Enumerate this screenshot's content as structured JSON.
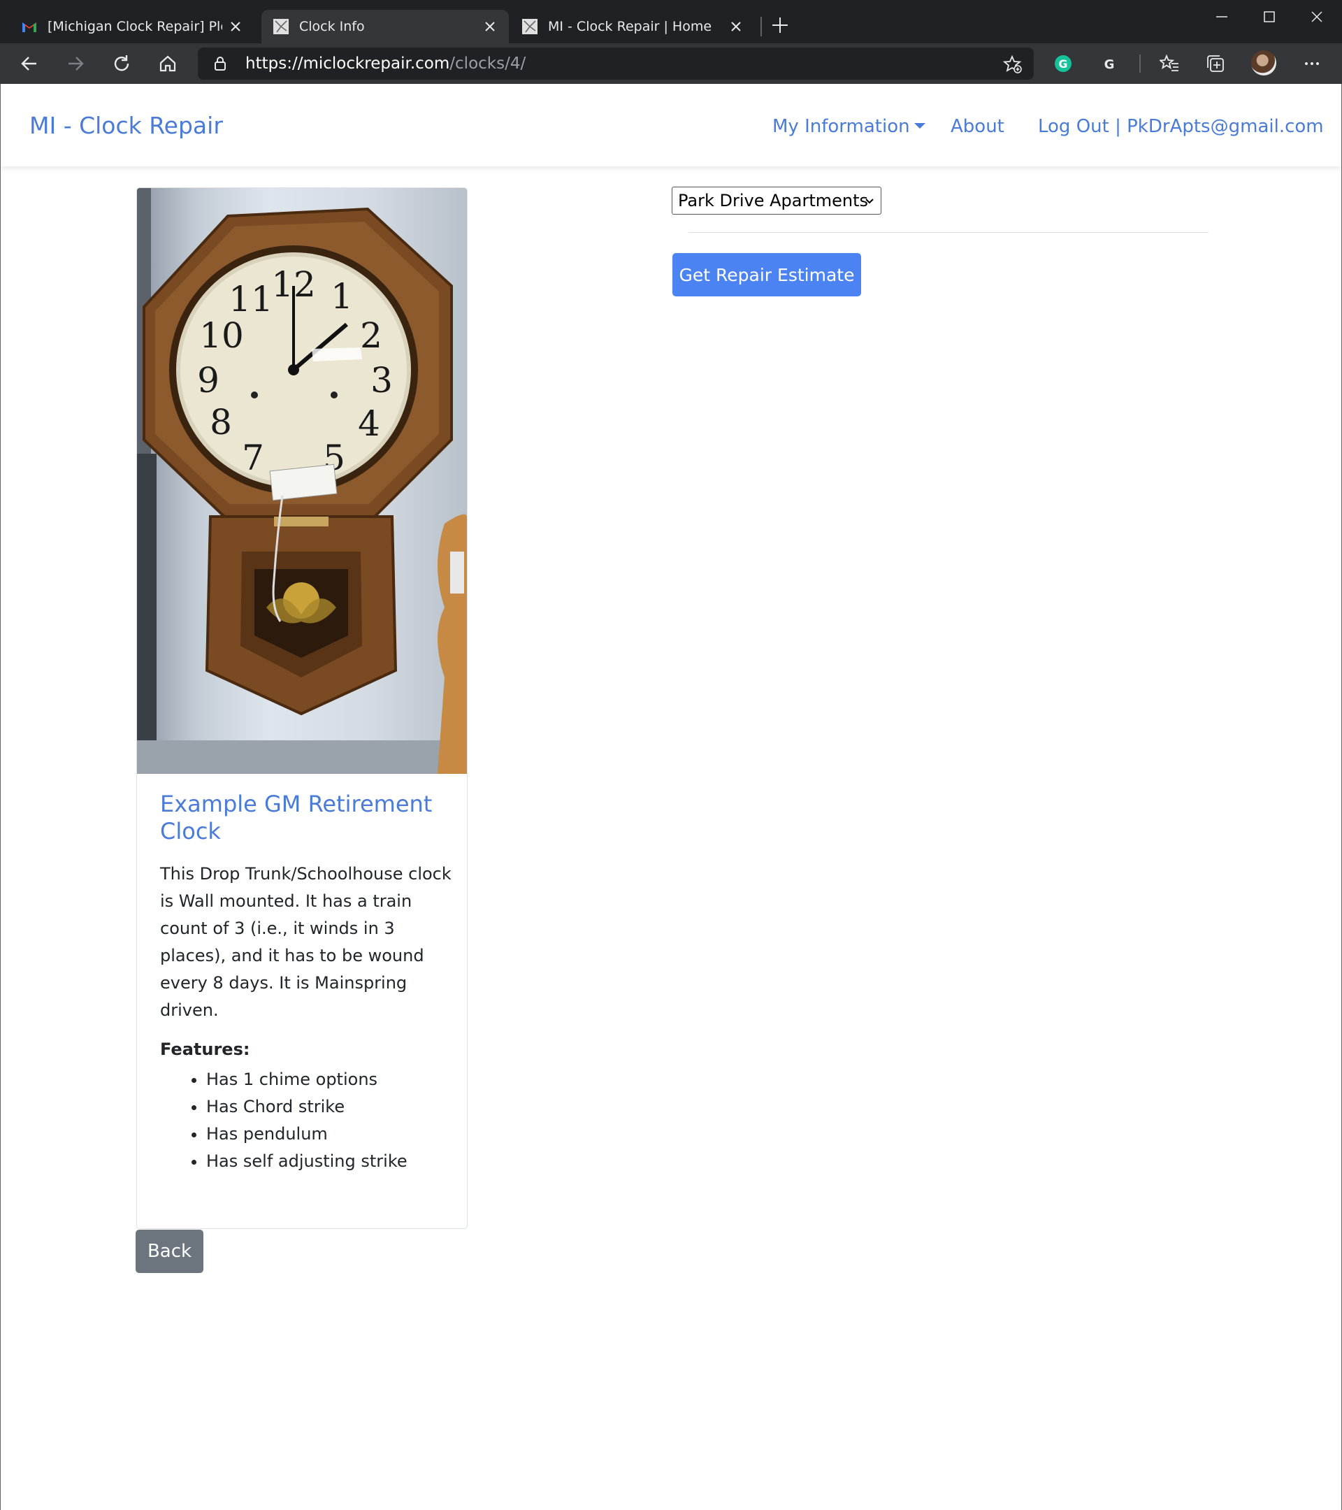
{
  "browser": {
    "tabs": [
      {
        "title": "[Michigan Clock Repair] Please C"
      },
      {
        "title": "Clock Info"
      },
      {
        "title": "MI - Clock Repair | Home"
      }
    ],
    "url_host": "https://miclockrepair.com",
    "url_path": "/clocks/4/"
  },
  "nav": {
    "brand": "MI - Clock Repair",
    "my_information": "My Information",
    "about": "About",
    "logout": "Log Out | PkDrApts@gmail.com"
  },
  "clock": {
    "title": "Example GM Retirement Clock",
    "description": "This Drop Trunk/Schoolhouse clock is Wall mounted. It has a train count of 3 (i.e., it winds in 3 places), and it has to be wound every 8 days. It is Mainspring driven.",
    "features_label": "Features:",
    "features": [
      "Has 1 chime options",
      "Has Chord strike",
      "Has pendulum",
      "Has self adjusting strike"
    ],
    "image_alt": "clock photo"
  },
  "location_select": {
    "selected": "Park Drive Apartments"
  },
  "buttons": {
    "estimate": "Get Repair Estimate",
    "back": "Back"
  },
  "icons": [
    "gmail-icon",
    "site-favicon",
    "close-icon",
    "plus-icon",
    "back-icon",
    "forward-icon",
    "reload-icon",
    "home-icon",
    "lock-icon",
    "favorite-add-icon",
    "grammarly-icon",
    "extension-g-icon",
    "favorites-icon",
    "collections-icon",
    "profile-avatar",
    "more-icon"
  ],
  "colors": {
    "link": "#4a7bd9",
    "primary": "#4b84f2",
    "secondary": "#6c757d",
    "chrome_dark": "#202124"
  }
}
